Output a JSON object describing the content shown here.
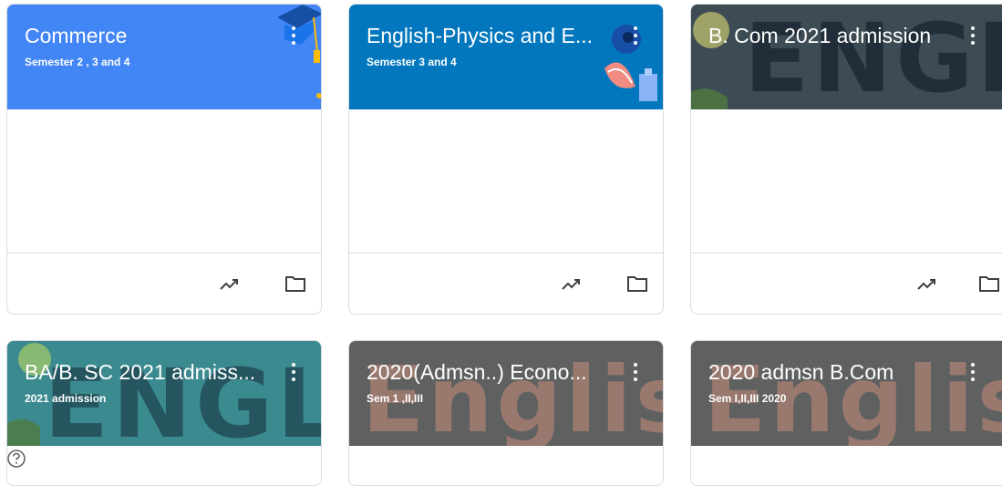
{
  "classes": [
    {
      "title": "Commerce",
      "subtitle": "Semester 2 , 3 and 4",
      "banner_color": "#4285f4"
    },
    {
      "title": "English-Physics and E...",
      "subtitle": "Semester 3 and 4",
      "banner_color": "#0277bd"
    },
    {
      "title": "B. Com 2021 admission",
      "subtitle": "",
      "banner_color": "#3d4b55"
    },
    {
      "title": "BA/B. SC 2021 admiss...",
      "subtitle": "2021 admission",
      "banner_color": "#3b8a8f"
    },
    {
      "title": "2020(Admsn..) Econo...",
      "subtitle": "Sem 1 ,II,III",
      "banner_color": "#5f6161"
    },
    {
      "title": "2020 admsn B.Com",
      "subtitle": "Sem I,II,III 2020",
      "banner_color": "#5f6161"
    }
  ],
  "banner_art": {
    "english_word": "ENGLIS",
    "english_colored_word": "English"
  },
  "icons": {
    "menu": "more-vert-icon",
    "trend": "trending-up-icon",
    "folder": "folder-icon",
    "help": "help-icon"
  }
}
